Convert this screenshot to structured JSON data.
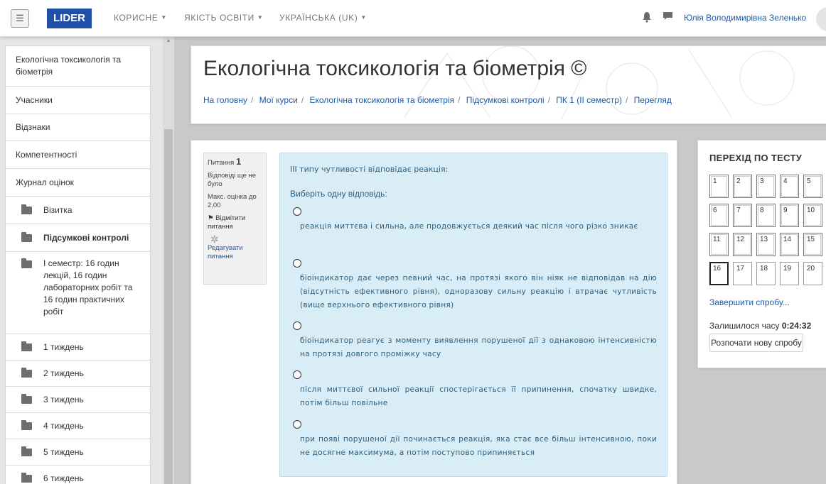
{
  "navbar": {
    "toggle_icon": "menu-icon",
    "toggle_glyph": "☰",
    "brand": "LIDER",
    "menus": [
      {
        "label": "КОРИСНЕ"
      },
      {
        "label": "ЯКІСТЬ ОСВІТИ"
      },
      {
        "label": "УКРАЇНСЬКА (UK)"
      }
    ],
    "user_name": "Юлія Володимирівна Зеленько",
    "brand_color": "#1f4fa6"
  },
  "drawer": {
    "items": [
      {
        "label": "Екологічна токсикологія та біометрія"
      },
      {
        "label": "Учасники"
      },
      {
        "label": "Відзнаки"
      },
      {
        "label": "Компетентності"
      },
      {
        "label": "Журнал оцінок"
      }
    ],
    "folders": [
      {
        "label": "Візитка"
      },
      {
        "label": "Підсумкові контролі"
      },
      {
        "label": "I семестр: 16 годин лекцій, 16 годин лабораторних робіт та 16 годин практичних робіт"
      },
      {
        "label": "1 тиждень"
      },
      {
        "label": "2 тиждень"
      },
      {
        "label": "3 тиждень"
      },
      {
        "label": "4 тиждень"
      },
      {
        "label": "5 тиждень"
      },
      {
        "label": "6 тиждень"
      }
    ]
  },
  "header": {
    "title": "Екологічна токсикологія та біометрія ©",
    "breadcrumb": [
      "На головну",
      "Мої курси",
      "Екологічна токсикологія та біометрія",
      "Підсумкові контролі",
      "ПК 1 (ІІ семестр)",
      "Перегляд"
    ]
  },
  "question": {
    "label": "Питання",
    "number": "1",
    "status": "Відповіді ще не було",
    "max_grade": "Макс. оцінка до 2,00",
    "flag_label": "Відмітити питання",
    "edit_label": "Редагувати питання",
    "text": "ІІІ типу чутливості відповідає реакція:",
    "prompt": "Виберіть одну відповідь:",
    "answers": [
      " реакція миттєва і сильна, але продовжується деякий час після чого різко зникає",
      "біоіндикатор дає через певний час, на протязі якого він ніяк не відповідав на дію (відсутність ефективного рівня), одноразову сильну реакцію і втрачає чутливість (вище верхнього ефективного рівня)",
      "біоіндикатор реагує з моменту виявлення порушеної дії з однаковою інтенсивністю на протязі довгого проміжку часу",
      "після миттєвої сильної реакції спостерігається її припинення, спочатку швидке, потім більш повільне",
      "при появі порушеної дії починається реакція, яка стає все більш інтенсивною, поки не досягне максимума, а потім поступово припиняється"
    ],
    "panel_color": "#d9edf7"
  },
  "quiznav": {
    "title": "ПЕРЕХІД ПО ТЕСТУ",
    "buttons": [
      "1",
      "2",
      "3",
      "4",
      "5",
      "6",
      "7",
      "8",
      "9",
      "10",
      "11",
      "12",
      "13",
      "14",
      "15",
      "16",
      "17",
      "18",
      "19",
      "20"
    ],
    "current": "16",
    "finish_link": "Завершити спробу...",
    "timer_label": "Залишилося часу",
    "timer_value": "0:24:32",
    "new_attempt": "Розпочати нову спробу"
  }
}
